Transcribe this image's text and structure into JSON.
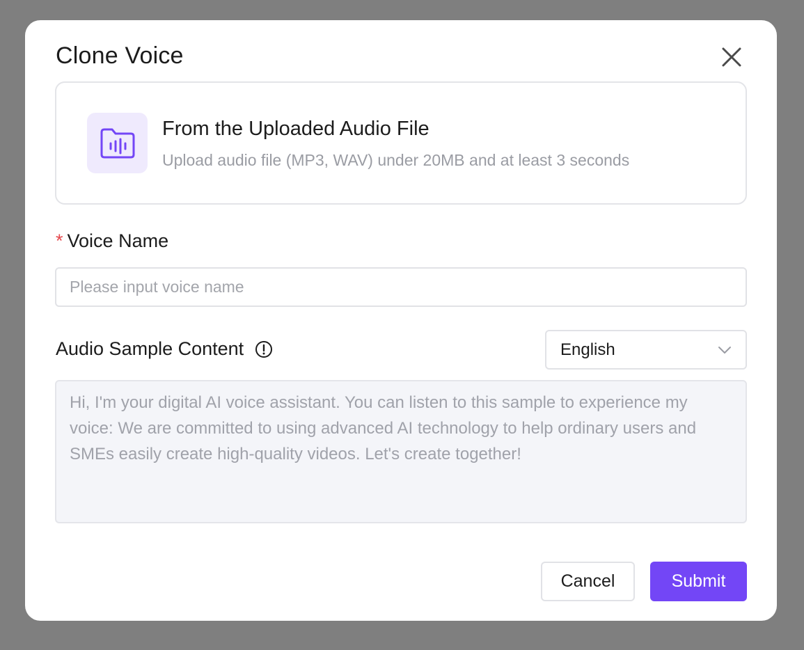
{
  "modal": {
    "title": "Clone Voice"
  },
  "upload_card": {
    "icon": "audio-folder-icon",
    "title": "From the Uploaded Audio File",
    "description": "Upload audio file (MP3, WAV) under 20MB and at least 3 seconds"
  },
  "voice_name": {
    "required_mark": "*",
    "label": "Voice Name",
    "placeholder": "Please input voice name",
    "value": ""
  },
  "audio_sample": {
    "label": "Audio Sample Content",
    "info_icon": "info-circle-icon",
    "language_selected": "English",
    "content": "Hi, I'm your digital AI voice assistant. You can listen to this sample to experience my voice: We are committed to using advanced AI technology to help ordinary users and SMEs easily create high-quality videos. Let's create together!"
  },
  "footer": {
    "cancel_label": "Cancel",
    "submit_label": "Submit"
  },
  "colors": {
    "overlay": "#7f7f7f",
    "accent": "#7346f6",
    "icon_bg": "#efeafd",
    "required": "#e5484d"
  }
}
